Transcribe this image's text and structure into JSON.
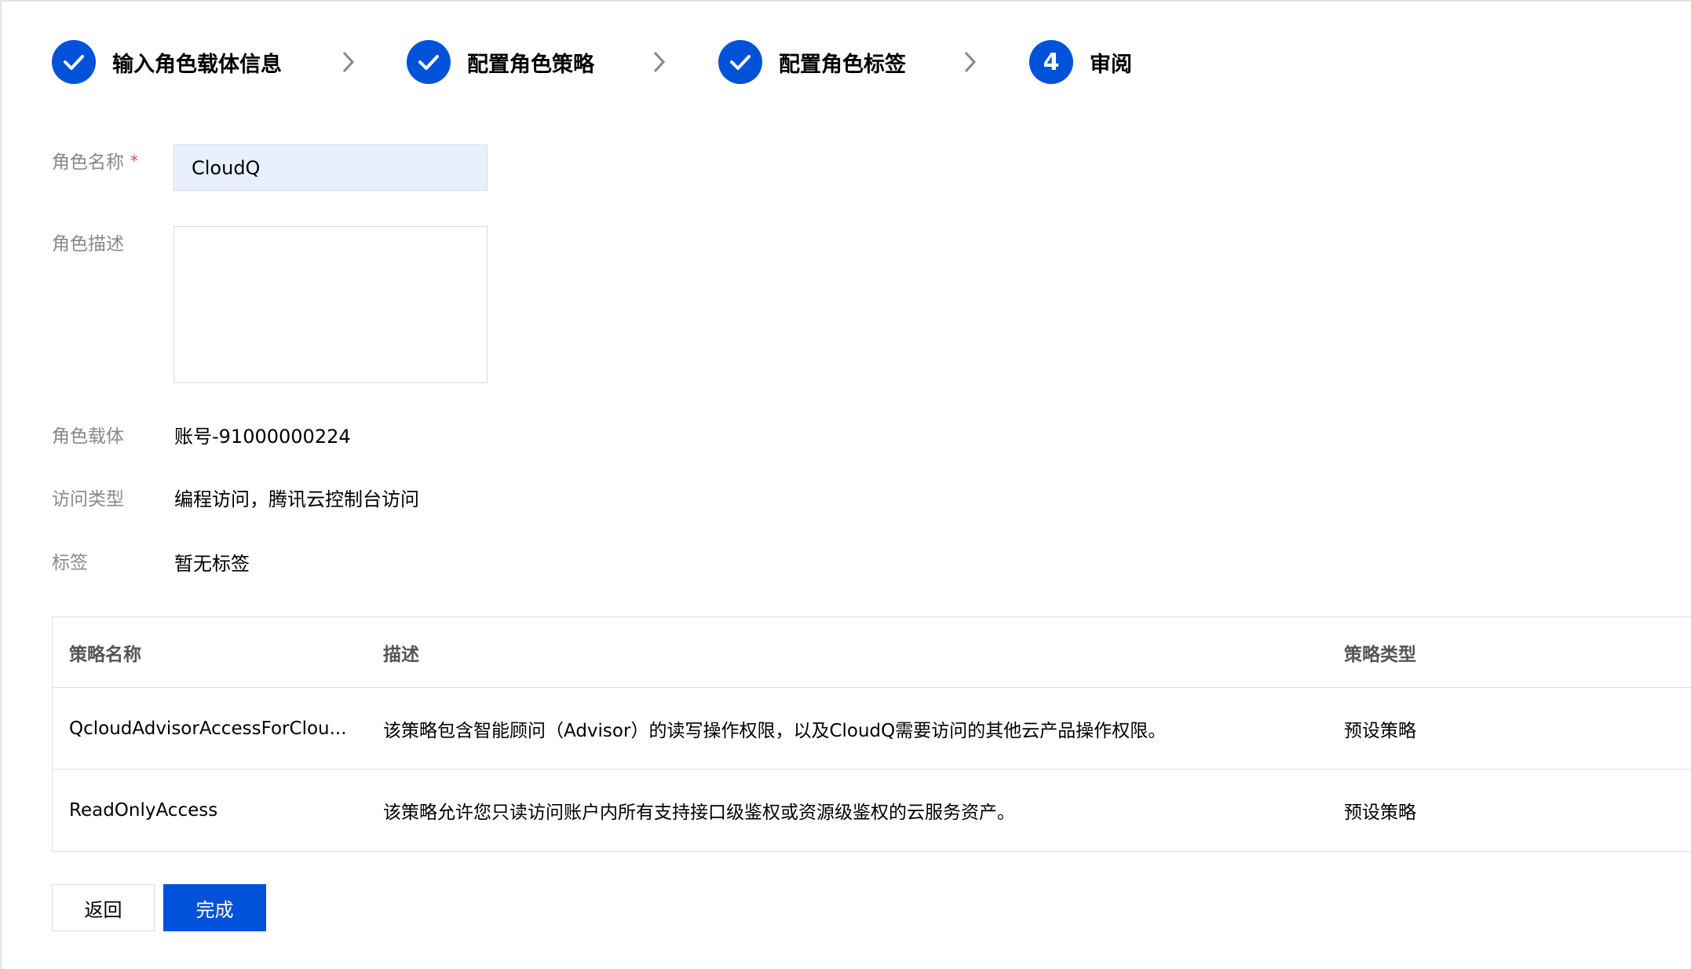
{
  "colors": {
    "primary": "#0052d9",
    "label_gray": "#888888",
    "border": "#dfe2e7",
    "input_bg": "#e8f0fe",
    "required": "#e54545"
  },
  "steps": [
    {
      "label": "输入角色载体信息",
      "status": "done",
      "icon": "check-icon"
    },
    {
      "label": "配置角色策略",
      "status": "done",
      "icon": "check-icon"
    },
    {
      "label": "配置角色标签",
      "status": "done",
      "icon": "check-icon"
    },
    {
      "label": "审阅",
      "status": "current",
      "number": "4"
    }
  ],
  "form": {
    "role_name": {
      "label": "角色名称",
      "required_mark": "*",
      "value": "CloudQ"
    },
    "role_desc": {
      "label": "角色描述",
      "value": ""
    },
    "role_carrier": {
      "label": "角色载体",
      "value": "账号-91000000224"
    },
    "access_type": {
      "label": "访问类型",
      "value": "编程访问，腾讯云控制台访问"
    },
    "tags": {
      "label": "标签",
      "value": "暂无标签"
    }
  },
  "policy_table": {
    "columns": [
      "策略名称",
      "描述",
      "策略类型"
    ],
    "rows": [
      [
        "QcloudAdvisorAccessForClou...",
        "该策略包含智能顾问（Advisor）的读写操作权限，以及CloudQ需要访问的其他云产品操作权限。",
        "预设策略"
      ],
      [
        "ReadOnlyAccess",
        "该策略允许您只读访问账户内所有支持接口级鉴权或资源级鉴权的云服务资产。",
        "预设策略"
      ]
    ]
  },
  "buttons": {
    "back": "返回",
    "done": "完成"
  }
}
